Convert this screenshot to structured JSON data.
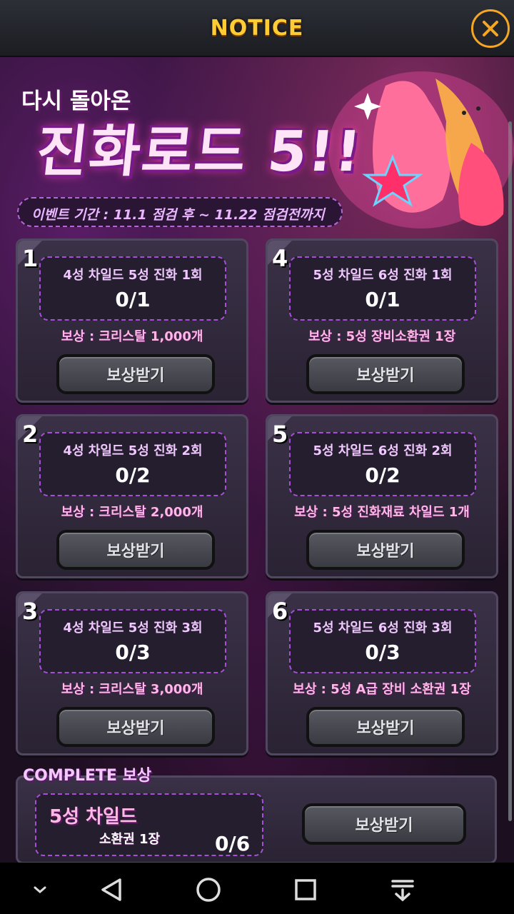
{
  "header": {
    "title": "NOTICE",
    "close_icon": "close-icon"
  },
  "banner": {
    "subtitle": "다시 돌아온",
    "title": "진화로드 5!!",
    "period": "이벤트 기간 : 11.1 점검 후 ~ 11.22 점검전까지"
  },
  "cards": [
    {
      "number": "1",
      "mission": "4성 차일드 5성 진화 1회",
      "progress": "0/1",
      "reward": "보상 : 크리스탈 1,000개",
      "button": "보상받기"
    },
    {
      "number": "4",
      "mission": "5성 차일드 6성 진화 1회",
      "progress": "0/1",
      "reward": "보상 : 5성 장비소환권 1장",
      "button": "보상받기"
    },
    {
      "number": "2",
      "mission": "4성 차일드 5성 진화 2회",
      "progress": "0/2",
      "reward": "보상 : 크리스탈 2,000개",
      "button": "보상받기"
    },
    {
      "number": "5",
      "mission": "5성 차일드 6성 진화 2회",
      "progress": "0/2",
      "reward": "보상 : 5성 진화재료 차일드 1개",
      "button": "보상받기"
    },
    {
      "number": "3",
      "mission": "4성 차일드 5성 진화 3회",
      "progress": "0/3",
      "reward": "보상 : 크리스탈 3,000개",
      "button": "보상받기"
    },
    {
      "number": "6",
      "mission": "5성 차일드 6성 진화 3회",
      "progress": "0/3",
      "reward": "보상 : 5성 A급 장비 소환권 1장",
      "button": "보상받기"
    }
  ],
  "complete": {
    "title": "COMPLETE 보상",
    "reward_line1": "5성 차일드",
    "reward_line2": "소환권 1장",
    "progress": "0/6",
    "button": "보상받기"
  },
  "navbar": {
    "items": [
      "chevron-down-icon",
      "back-icon",
      "home-icon",
      "recents-icon",
      "download-icon"
    ]
  },
  "colors": {
    "accent": "#ffcc33",
    "mission_border": "#a84fd9",
    "reward_text": "#ffb7e5"
  }
}
